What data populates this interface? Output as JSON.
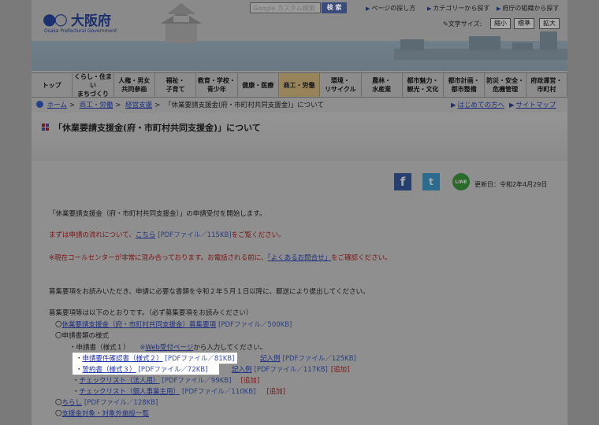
{
  "header": {
    "logo_name": "大阪府",
    "logo_sub": "Osaka Prefectural Government",
    "search_placeholder": "Google カスタム検索",
    "search_button": "検 索",
    "links": [
      "ページの探し方",
      "カテゴリーから探す",
      "府庁の組織から探す"
    ],
    "fontsize_label": "文字サイズ:",
    "fontsize_buttons": [
      "縮小",
      "標準",
      "拡大"
    ]
  },
  "nav": [
    "トップ",
    "くらし・住まい\nまちづくり",
    "人権・男女\n共同参画",
    "福祉・\n子育て",
    "教育・学校・\n青少年",
    "健康・医療",
    "商工・労働",
    "環境・\nリサイクル",
    "農林・\n水産業",
    "都市魅力・\n観光・文化",
    "都市計画・\n都市整備",
    "防災・安全・\n危機管理",
    "府政運営・\n市町村"
  ],
  "breadcrumb": {
    "items": [
      "ホーム",
      "商工・労働",
      "経営支援"
    ],
    "current": "「休業要請支援金(府・市町村共同支援金)」について",
    "right_links": [
      "はじめての方へ",
      "サイトマップ"
    ]
  },
  "title": "「休業要請支援金(府・市町村共同支援金)」について",
  "updated": "更新日：令和2年4月29日",
  "body": {
    "intro": "「休業要請支援金（府・市町村共同支援金）」の申請受付を開始します。",
    "flow_pre": "まずは申請の流れについて、",
    "flow_link": "こちら",
    "flow_pdf": "[PDFファイル／115KB]",
    "flow_post": "をご覧ください。",
    "call_pre": "※現在コールセンターが非常に混み合っております。お電話される前に、",
    "call_link": "「よくあるお問合せ」",
    "call_post": "をご確認ください。",
    "guide": "募集要項をお読みいただき、申請に必要な書類を令和２年５月１日以降に、郵送により提出してください。",
    "list_intro": "募集要項等は以下のとおりです。（必ず募集要項をお読みください）",
    "item1_link": "休業要請支援金（府・市町村共同支援金）募集要項",
    "item1_pdf": "[PDFファイル／500KB]",
    "item2": "〇申請書類の様式",
    "sub1": "・申請書（様式１）",
    "sub1_note_pre": "※",
    "sub1_note_link": "Web受付ページ",
    "sub1_note_post": "から入力してください。",
    "sub2_link": "申請要件確認書（様式２）",
    "sub2_pdf": "[PDFファイル／81KB]",
    "sub2_ex": "記入例",
    "sub2_ex_pdf": "[PDFファイル／125KB]",
    "sub3_link": "誓約書（様式３）",
    "sub3_pdf": "[PDFファイル／72KB]",
    "sub3_ex": "記入例",
    "sub3_ex_pdf": "[PDFファイル／117KB]",
    "sub3_add": "[追加]",
    "sub4_link": "チェックリスト（法人用）",
    "sub4_pdf": "[PDFファイル／99KB]",
    "sub4_add": "[追加]",
    "sub5_link": "チェックリスト（個人事業主用）",
    "sub5_pdf": "[PDFファイル／110KB]",
    "sub5_add": "[追加]",
    "item3_link": "ちらし",
    "item3_pdf": "[PDFファイル／128KB]",
    "item4_link": "支援金対象・対象外施設一覧",
    "bullet": "〇",
    "dot": "・"
  }
}
